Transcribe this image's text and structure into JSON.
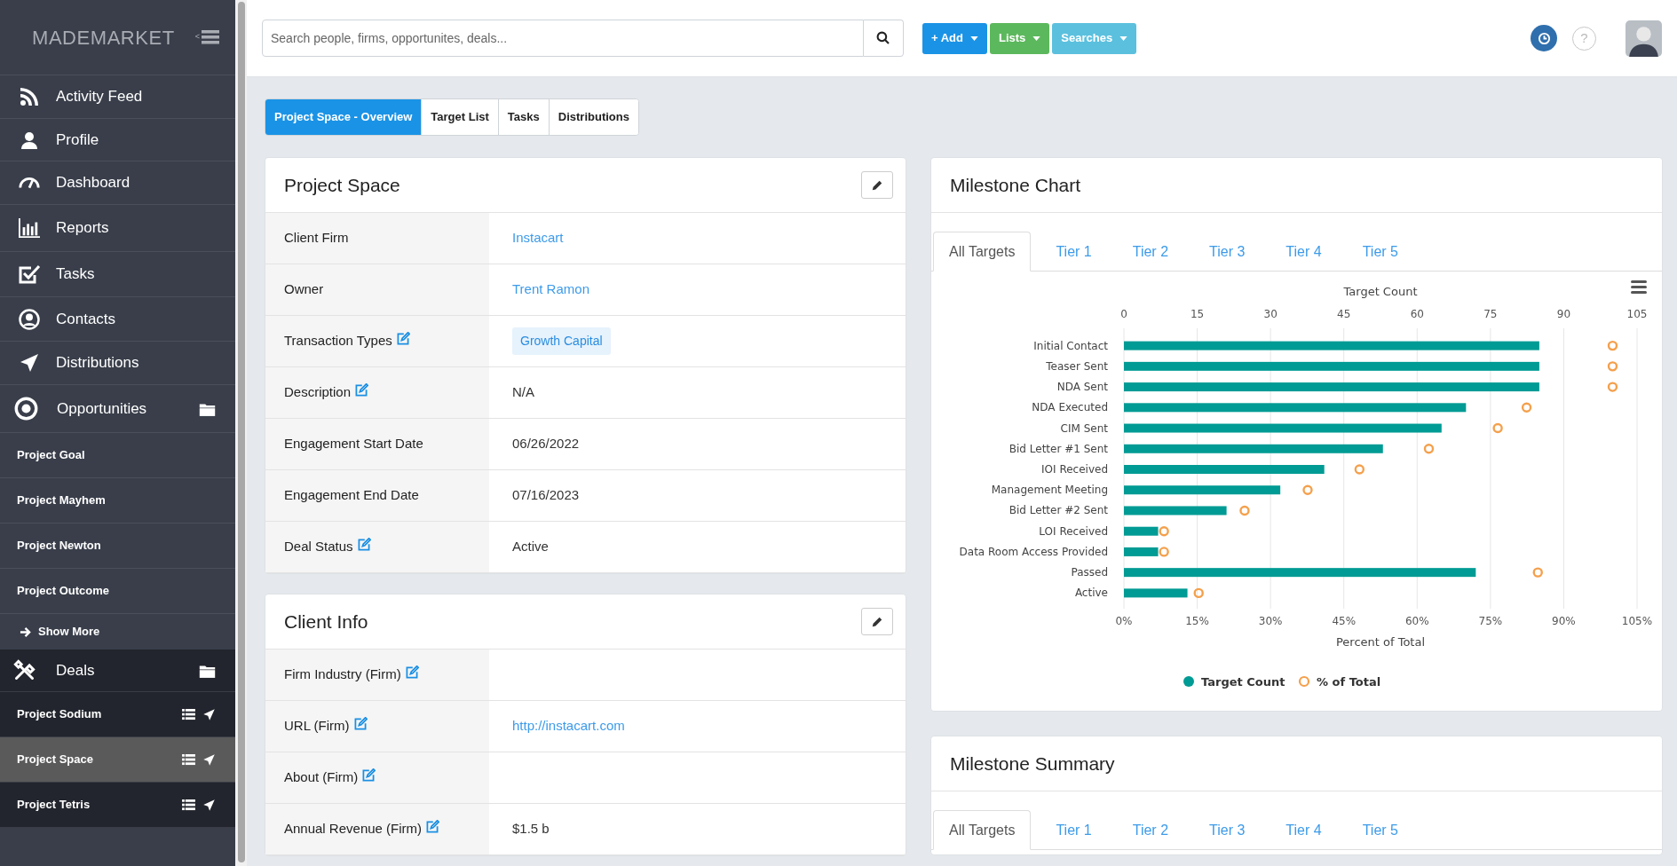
{
  "sidebar": {
    "logo": "MADEMARKET",
    "collapse_label": "<",
    "nav": [
      {
        "label": "Activity Feed"
      },
      {
        "label": "Profile"
      },
      {
        "label": "Dashboard"
      },
      {
        "label": "Reports"
      },
      {
        "label": "Tasks"
      },
      {
        "label": "Contacts"
      },
      {
        "label": "Distributions"
      }
    ],
    "opportunities": {
      "label": "Opportunities",
      "items": [
        {
          "label": "Project Goal"
        },
        {
          "label": "Project Mayhem"
        },
        {
          "label": "Project Newton"
        },
        {
          "label": "Project Outcome"
        }
      ],
      "show_more": "Show More"
    },
    "deals": {
      "label": "Deals",
      "items": [
        {
          "label": "Project Sodium",
          "selected": false
        },
        {
          "label": "Project Space",
          "selected": true
        },
        {
          "label": "Project Tetris",
          "selected": false
        }
      ]
    }
  },
  "topbar": {
    "search": {
      "placeholder": "Search people, firms, opportunites, deals..."
    },
    "buttons": [
      {
        "label": "+ Add",
        "color": "#1a93e6"
      },
      {
        "label": "Lists",
        "color": "#5cb85c"
      },
      {
        "label": "Searches",
        "color": "#5bc0de"
      }
    ],
    "help_label": "?"
  },
  "page_tabs": [
    {
      "label": "Project Space - Overview",
      "selected": true
    },
    {
      "label": "Target List",
      "selected": false
    },
    {
      "label": "Tasks",
      "selected": false
    },
    {
      "label": "Distributions",
      "selected": false
    }
  ],
  "project_card": {
    "title": "Project Space",
    "rows": [
      {
        "label": "Client Firm",
        "editable": false,
        "value": "Instacart",
        "kind": "link"
      },
      {
        "label": "Owner",
        "editable": false,
        "value": "Trent Ramon",
        "kind": "link"
      },
      {
        "label": "Transaction Types",
        "editable": true,
        "value": "Growth Capital",
        "kind": "tag"
      },
      {
        "label": "Description",
        "editable": true,
        "value": "N/A",
        "kind": "text"
      },
      {
        "label": "Engagement Start Date",
        "editable": false,
        "value": "06/26/2022",
        "kind": "text"
      },
      {
        "label": "Engagement End Date",
        "editable": false,
        "value": "07/16/2023",
        "kind": "text"
      },
      {
        "label": "Deal Status",
        "editable": true,
        "value": "Active",
        "kind": "text"
      }
    ]
  },
  "client_card": {
    "title": "Client Info",
    "rows": [
      {
        "label": "Firm Industry (Firm)",
        "editable": true
      },
      {
        "label": "URL (Firm)",
        "editable": true,
        "value": "http://instacart.com",
        "kind": "link"
      },
      {
        "label": "About (Firm)",
        "editable": true
      },
      {
        "label": "Annual Revenue (Firm)",
        "editable": true,
        "value": "$1.5 b",
        "kind": "text"
      }
    ]
  },
  "milestone_chart": {
    "title": "Milestone Chart",
    "tabs": [
      {
        "label": "All Targets",
        "selected": true
      },
      {
        "label": "Tier 1",
        "selected": false
      },
      {
        "label": "Tier 2",
        "selected": false
      },
      {
        "label": "Tier 3",
        "selected": false
      },
      {
        "label": "Tier 4",
        "selected": false
      },
      {
        "label": "Tier 5",
        "selected": false
      }
    ],
    "percent_axis": {
      "label": "Percent of Total",
      "ticks": [
        "0%",
        "15%",
        "30%",
        "45%",
        "60%",
        "75%",
        "90%",
        "105%"
      ]
    },
    "chart_data": {
      "type": "bar",
      "orientation": "horizontal",
      "xlabel": "Target Count",
      "categories": [
        "Initial Contact",
        "Teaser Sent",
        "NDA Sent",
        "NDA Executed",
        "CIM Sent",
        "Bid Letter #1 Sent",
        "IOI Received",
        "Management Meeting",
        "Bid Letter #2 Sent",
        "LOI Received",
        "Data Room Access Provided",
        "Passed",
        "Active"
      ],
      "series": [
        {
          "name": "Target Count",
          "type": "bar",
          "color": "#009b94",
          "values": [
            85,
            85,
            85,
            70,
            65,
            53,
            41,
            32,
            21,
            7,
            7,
            72,
            13
          ]
        },
        {
          "name": "% of Total",
          "type": "scatter",
          "color": "#f4a04c",
          "values": [
            100,
            100,
            100,
            82.4,
            76.5,
            62.4,
            48.2,
            37.6,
            24.7,
            8.2,
            8.2,
            84.7,
            15.3
          ]
        }
      ],
      "xlim": [
        0,
        105
      ],
      "xticks": [
        0,
        15,
        30,
        45,
        60,
        75,
        90,
        105
      ],
      "grid": true,
      "legend": true
    }
  },
  "milestone_summary": {
    "title": "Milestone Summary",
    "tabs": [
      {
        "label": "All Targets",
        "selected": true
      },
      {
        "label": "Tier 1",
        "selected": false
      },
      {
        "label": "Tier 2",
        "selected": false
      },
      {
        "label": "Tier 3",
        "selected": false
      },
      {
        "label": "Tier 4",
        "selected": false
      },
      {
        "label": "Tier 5",
        "selected": false
      }
    ]
  }
}
